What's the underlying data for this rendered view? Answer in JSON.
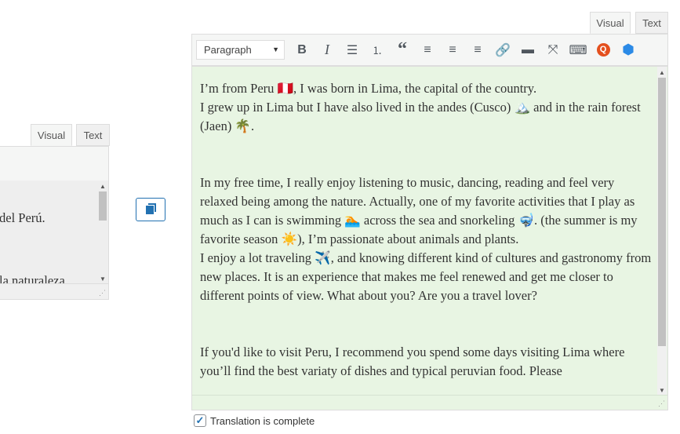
{
  "left_editor": {
    "tabs": [
      "Visual",
      "Text"
    ],
    "lines": [
      "del Perú.",
      "la naturaleza"
    ]
  },
  "copy_button": {
    "icon": "copy-icon"
  },
  "right_editor": {
    "tabs": [
      "Visual",
      "Text"
    ],
    "format_select": "Paragraph",
    "toolbar": [
      "bold",
      "italic",
      "bullet-list",
      "numbered-list",
      "blockquote",
      "align-left",
      "align-center",
      "align-right",
      "link",
      "read-more",
      "fullscreen",
      "toolbar-toggle",
      "quform",
      "plugin"
    ],
    "paragraphs": [
      "I’m from Peru 🇵🇪, I was born in Lima, the capital of the country.",
      "I grew up in Lima but I have also lived in the andes (Cusco) 🏔️ and in the rain forest (Jaen) 🌴.",
      "In my free time, I really enjoy listening to music, dancing, reading and feel very relaxed being among the nature. Actually, one of my favorite activities that I play as much as I can is swimming 🏊 across the sea and snorkeling 🤿. (the summer is my favorite season ☀️), I’m passionate about animals and plants.",
      "I enjoy a lot traveling ✈️, and knowing different kind of cultures and gastronomy from new places. It is an experience that makes me feel renewed and get me closer to different points of view. What about you? Are you a travel lover?",
      "If you'd like to visit Peru, I recommend you spend some days visiting Lima where you’ll find the best variaty of dishes and typical peruvian food. Please"
    ]
  },
  "translation_complete": {
    "label": "Translation is complete",
    "checked": true
  }
}
